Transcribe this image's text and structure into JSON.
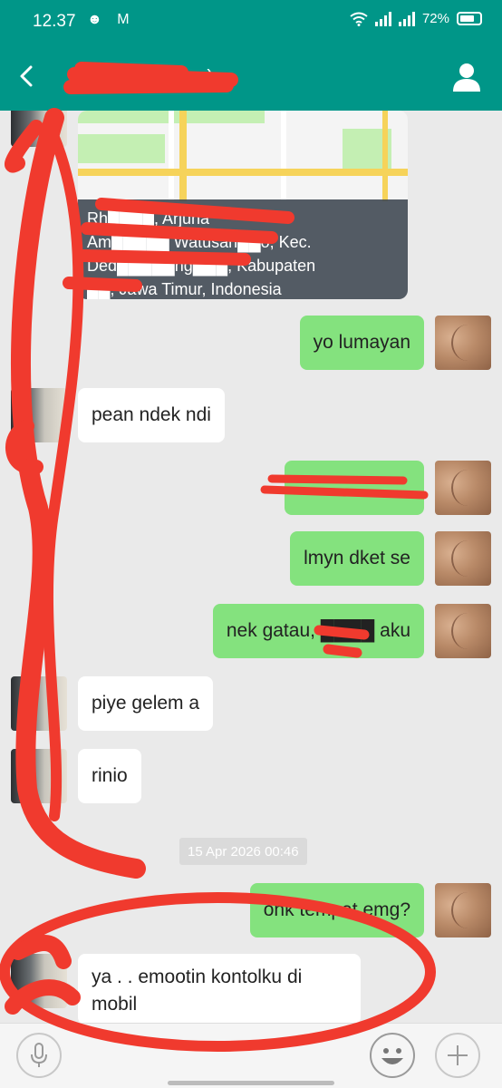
{
  "status_bar": {
    "time": "12.37",
    "app_icons": "☻ M",
    "battery_pct": "72%"
  },
  "header": {
    "contact_name": "Y████ (Tenan)"
  },
  "location": {
    "caption_lines": [
      "Rh████, Arjuna",
      "Am█████ Watusari██o, Kec.",
      "Ded█████ng███, Kabupaten",
      "██, Jawa Timur, Indonesia"
    ]
  },
  "messages": [
    {
      "dir": "out",
      "text": "yo lumayan"
    },
    {
      "dir": "in",
      "text": "pean ndek ndi"
    },
    {
      "dir": "out",
      "text": "██████"
    },
    {
      "dir": "out",
      "text": "lmyn dket se"
    },
    {
      "dir": "out",
      "text": "nek gatau, ████ aku"
    },
    {
      "dir": "in",
      "text": "piye gelem a"
    },
    {
      "dir": "in",
      "text": "rinio"
    },
    {
      "dir": "out",
      "text": "onk tempat emg?"
    },
    {
      "dir": "in",
      "text": "ya . . emootin kontolku di mobil"
    }
  ],
  "date_separator": "15 Apr 2026 00:46",
  "composer": {
    "placeholder": ""
  },
  "icons": {
    "back": "back-arrow-icon",
    "profile": "person-icon",
    "mic": "microphone-icon",
    "emoji": "smiley-icon",
    "add": "plus-icon"
  },
  "colors": {
    "header": "#009688",
    "outgoing": "#84e27e",
    "incoming": "#ffffff",
    "scribble": "#f03a2e"
  }
}
